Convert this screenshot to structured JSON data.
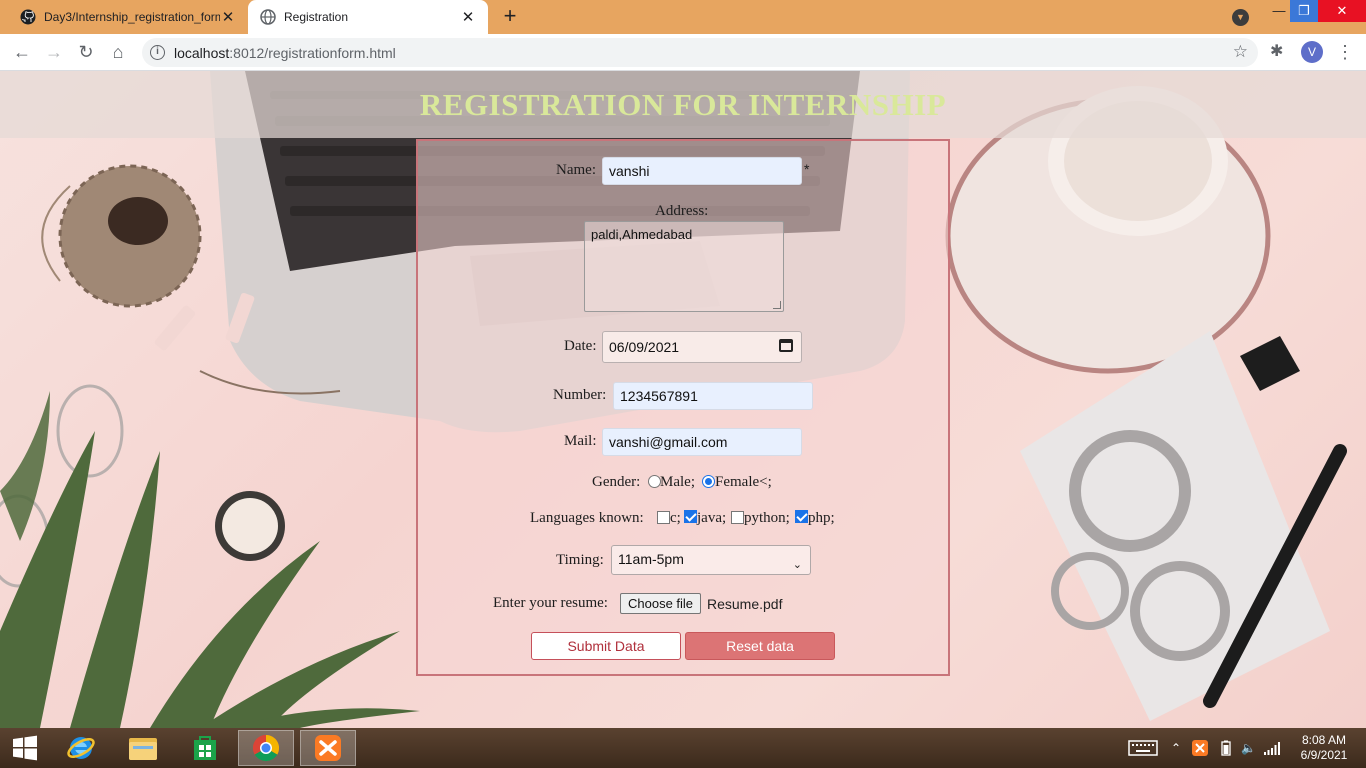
{
  "browser": {
    "tabs": [
      {
        "title": "Day3/Internship_registration_form",
        "favicon": "github-icon",
        "active": false
      },
      {
        "title": "Registration",
        "favicon": "globe-icon",
        "active": true
      }
    ],
    "new_tab": "+",
    "url": "localhost:8012/registrationform.html",
    "url_host": "localhost",
    "url_rest": ":8012/registrationform.html",
    "avatar_letter": "V"
  },
  "page": {
    "title": "REGISTRATION FOR INTERNSHIP",
    "form": {
      "name_label": "Name:",
      "name_value": "vanshi",
      "required_mark": "*",
      "address_label": "Address:",
      "address_value": "paldi,Ahmedabad",
      "date_label": "Date:",
      "date_value": "06/09/2021",
      "number_label": "Number:",
      "number_value": "1234567891",
      "mail_label": "Mail:",
      "mail_value": "vanshi@gmail.com",
      "gender_label": "Gender:",
      "gender_options": [
        {
          "label": "Male;",
          "checked": false
        },
        {
          "label": "Female<;",
          "checked": true
        }
      ],
      "languages_label": "Languages known:",
      "languages": [
        {
          "label": "c;",
          "checked": false
        },
        {
          "label": "java;",
          "checked": true
        },
        {
          "label": "python;",
          "checked": false
        },
        {
          "label": "php;",
          "checked": true
        }
      ],
      "timing_label": "Timing:",
      "timing_value": "11am-5pm",
      "resume_label": "Enter your resume:",
      "choose_file_label": "Choose file",
      "file_name": "Resume.pdf",
      "submit_label": "Submit Data",
      "reset_label": "Reset data"
    }
  },
  "taskbar": {
    "clock_time": "8:08 AM",
    "clock_date": "6/9/2021"
  },
  "colors": {
    "tabbar": "#e7a560",
    "title": "#d9e89a",
    "form_border": "#c8747a",
    "reset_button": "#dc7475"
  }
}
